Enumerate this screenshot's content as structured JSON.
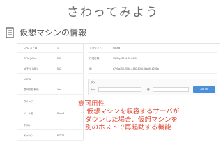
{
  "slide": {
    "title": "さわってみよう",
    "section_heading": "仮想マシンの情報",
    "section_icon": "document-icon"
  },
  "left_pane": {
    "rows": [
      {
        "key": "CPU コア数",
        "value": "1"
      },
      {
        "key": "CPU (MHz)",
        "value": "500"
      },
      {
        "key": "メモリ (MB)",
        "value": "512"
      },
      {
        "key": "VGPU",
        "value": ""
      },
      {
        "key": "高可用性有効",
        "value": "Yes"
      },
      {
        "key": "グループ",
        "value": ""
      },
      {
        "key": "ゾーン名",
        "value": "Zone4"
      },
      {
        "key": "ホスト",
        "value": ""
      },
      {
        "key": "ドメイン",
        "value": "ROOT"
      }
    ]
  },
  "right_pane": {
    "rows": [
      {
        "key": "アカウント",
        "value": "hoshiji"
      },
      {
        "key": "作成日時",
        "value": "15 Sep 2014 20:29:09"
      },
      {
        "key": "ID",
        "value": "e7e0a300-205d-4180-805f-3bad91b295a"
      }
    ],
    "tags": {
      "heading": "タグ",
      "key_label": "キー",
      "value_label": "値",
      "add_button": "Add tag"
    }
  },
  "note": {
    "line1": "高可用性",
    "line2": "… 仮想マシンを収容するサーバが",
    "line3": "ダウンした場合、仮想マシンを",
    "line4": "別のホストで再起動する機能"
  },
  "colors": {
    "accent_note": "#e0432f",
    "button": "#4a90d9"
  }
}
